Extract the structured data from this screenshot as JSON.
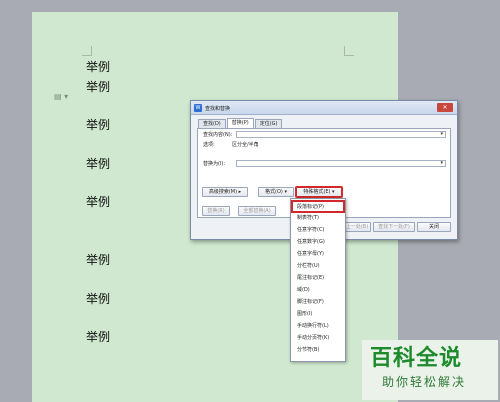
{
  "document": {
    "lines": [
      "举例",
      "举例",
      "举例",
      "举例",
      "举例",
      "举例",
      "举例",
      "举例"
    ]
  },
  "dialog": {
    "title": "查找和替换",
    "tabs": [
      "查找(D)",
      "替换(P)",
      "定位(G)"
    ],
    "find_label": "查找内容(N):",
    "find_value": "",
    "options_label": "选项:",
    "options_value": "区分全/半角",
    "replace_label": "替换为(I):",
    "replace_value": "",
    "buttons": {
      "advanced": "高级搜索(M) ▸",
      "format": "格式(O) ▾",
      "special": "特殊格式(E) ▾",
      "replace": "替换(R)",
      "replace_all": "全部替换(A)",
      "find_prev": "查找上一处(B)",
      "find_next": "查找下一处(F)",
      "close": "关闭"
    }
  },
  "menu": {
    "items": [
      "段落标记(P)",
      "制表符(T)",
      "任意字符(C)",
      "任意数字(G)",
      "任意字母(Y)",
      "分栏符(U)",
      "尾注标记(E)",
      "域(D)",
      "脚注标记(F)",
      "图形(I)",
      "手动换行符(L)",
      "手动分页符(K)",
      "分节符(B)"
    ],
    "highlighted_index": 0
  },
  "watermark": {
    "title": "百科全说",
    "subtitle": "助你轻松解决"
  }
}
